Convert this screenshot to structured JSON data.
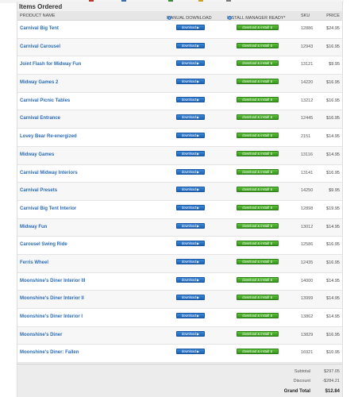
{
  "section": {
    "title": "Items Ordered"
  },
  "columns": {
    "product": "PRODUCT NAME",
    "download": "MANUAL DOWNLOAD",
    "install": "INSTALL MANAGER READY*",
    "sku": "SKU",
    "price": "PRICE"
  },
  "buttons": {
    "download_label": "download ▶",
    "install_label": "download & install ⬇"
  },
  "items": [
    {
      "name": "Carnival Big Tent",
      "sku": "12886",
      "price": "$24.95"
    },
    {
      "name": "Carnival Carousel",
      "sku": "12943",
      "price": "$16.95"
    },
    {
      "name": "Joint Flash for Midway Fun",
      "sku": "13121",
      "price": "$9.95"
    },
    {
      "name": "Midway Games 2",
      "sku": "14220",
      "price": "$16.95"
    },
    {
      "name": "Carnival Picnic Tables",
      "sku": "13212",
      "price": "$16.95"
    },
    {
      "name": "Carnival Entrance",
      "sku": "12445",
      "price": "$16.95"
    },
    {
      "name": "Lovey Bear Re-energized",
      "sku": "2151",
      "price": "$14.95"
    },
    {
      "name": "Midway Games",
      "sku": "13116",
      "price": "$14.95"
    },
    {
      "name": "Carnival Midway Interiors",
      "sku": "13141",
      "price": "$16.95"
    },
    {
      "name": "Carnival Presets",
      "sku": "14250",
      "price": "$9.95"
    },
    {
      "name": "Carnival Big Tent Interior",
      "sku": "12898",
      "price": "$19.95"
    },
    {
      "name": "Midway Fun",
      "sku": "13012",
      "price": "$14.95"
    },
    {
      "name": "Carousel Swing Ride",
      "sku": "12586",
      "price": "$16.95"
    },
    {
      "name": "Ferris Wheel",
      "sku": "12435",
      "price": "$16.95"
    },
    {
      "name": "Moonshine's Diner Interior III",
      "sku": "14000",
      "price": "$14.95"
    },
    {
      "name": "Moonshine's Diner Interior II",
      "sku": "13999",
      "price": "$14.95"
    },
    {
      "name": "Moonshine's Diner Interior I",
      "sku": "13862",
      "price": "$14.95"
    },
    {
      "name": "Moonshine's Diner",
      "sku": "13829",
      "price": "$16.95"
    },
    {
      "name": "Moonshine's Diner: Fallen",
      "sku": "16921",
      "price": "$10.95"
    }
  ],
  "totals": {
    "subtotal_label": "Subtotal",
    "subtotal": "$297.05",
    "discount_label": "Discount",
    "discount": "-$284.21",
    "grand_label": "Grand Total",
    "grand": "$12.84"
  },
  "colors": {
    "link": "#2b6cb7",
    "download_button": "#2a72c6",
    "install_button": "#46a82a"
  }
}
